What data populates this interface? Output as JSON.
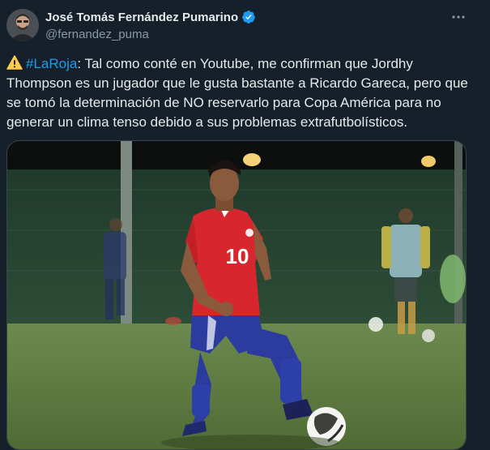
{
  "author": {
    "name": "José Tomás Fernández Pumarino",
    "handle": "@fernandez_puma",
    "verified": true
  },
  "tweet": {
    "hashtag": "#LaRoja",
    "text": ": Tal como conté en Youtube, me confirman que Jordhy Thompson es un jugador que le gusta bastante a Ricardo Gareca, pero que se tomó la determinación de NO reservarlo para Copa América para no generar un clima tenso debido a sus problemas extrafutbolísticos."
  },
  "media": {
    "description_icon": "photo-football-player",
    "jersey_number": "10"
  },
  "colors": {
    "background": "#15202b",
    "accent": "#1d9bf0",
    "text_primary": "#e7e9ea",
    "text_secondary": "#8b98a5",
    "jersey": "#d7262e",
    "shorts": "#2b3c9e"
  },
  "icons": {
    "more": "more-options-icon",
    "verified": "verified-badge-icon",
    "warning": "warning-emoji-icon"
  }
}
